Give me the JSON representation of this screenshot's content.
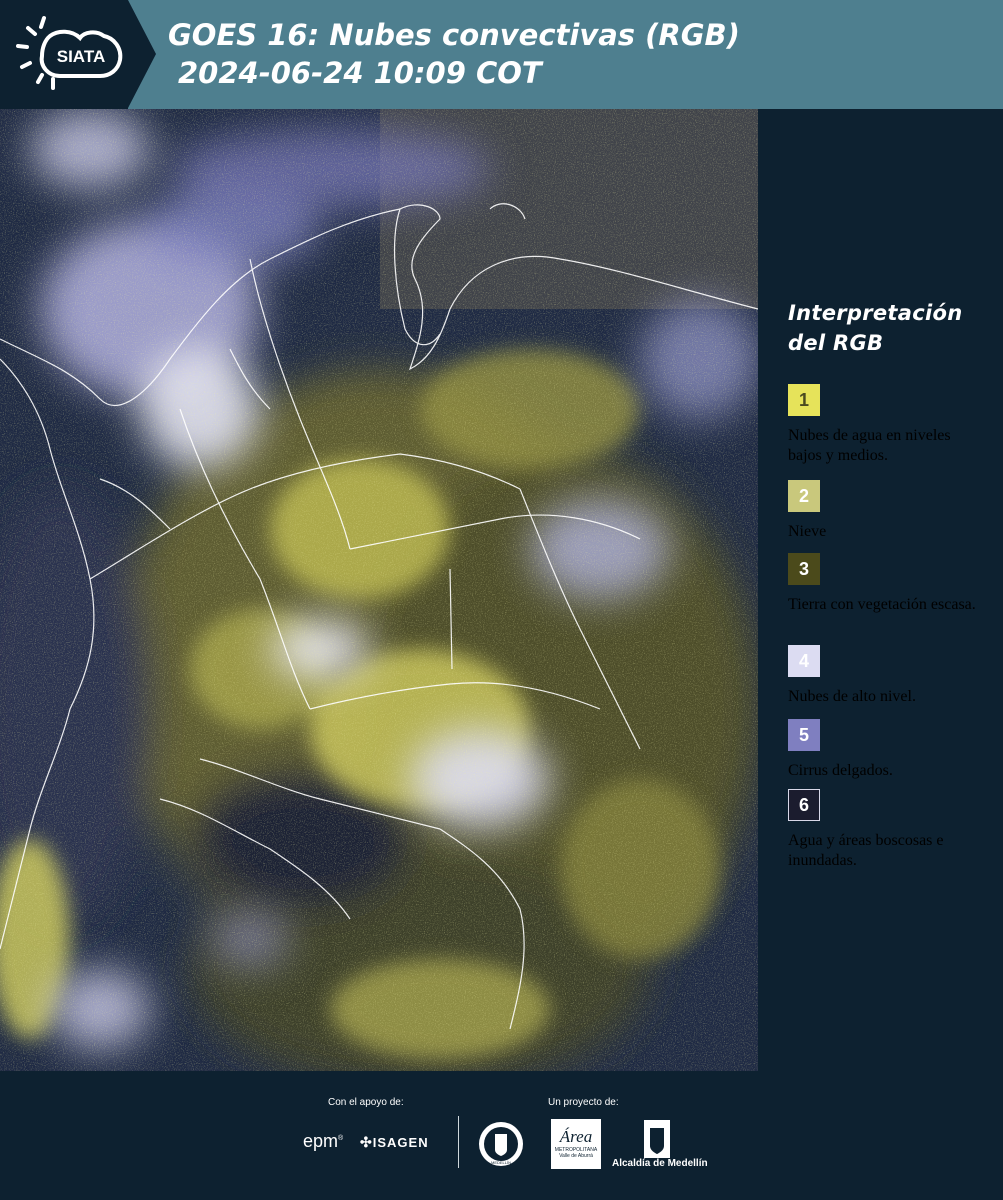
{
  "header": {
    "logo_text": "SIATA",
    "title_line1": "GOES 16: Nubes convectivas (RGB)",
    "title_line2": "2024-06-24 10:09 COT"
  },
  "legend": {
    "title_line1": "Interpretación",
    "title_line2": "del RGB",
    "items": [
      {
        "number": "1",
        "label": "Nubes de agua en niveles bajos y medios.",
        "color": "#e6e35a",
        "text_color": "#4a4a20"
      },
      {
        "number": "2",
        "label": "Nieve",
        "color": "#c9c87c",
        "text_color": "#ffffff"
      },
      {
        "number": "3",
        "label": "Tierra con vegetación escasa.",
        "color": "#4b4a1b",
        "text_color": "#ffffff"
      },
      {
        "number": "4",
        "label": "Nubes de alto nivel.",
        "color": "#dcdcf2",
        "text_color": "#ffffff"
      },
      {
        "number": "5",
        "label": "Cirrus delgados.",
        "color": "#7f7fc0",
        "text_color": "#ffffff"
      },
      {
        "number": "6",
        "label": "Agua y áreas boscosas e inundadas.",
        "color": "#1b1c2e",
        "text_color": "#ffffff"
      }
    ]
  },
  "footer": {
    "support_label": "Con el apoyo de:",
    "project_label": "Un proyecto de:",
    "sponsor1": "epm",
    "sponsor2": "ISAGEN",
    "partner1": "MEDELLÍN",
    "partner2_name": "Área",
    "partner2_sub1": "METROPOLITANA",
    "partner2_sub2": "Valle de Aburrá",
    "partner3": "Alcaldía de Medellín"
  }
}
